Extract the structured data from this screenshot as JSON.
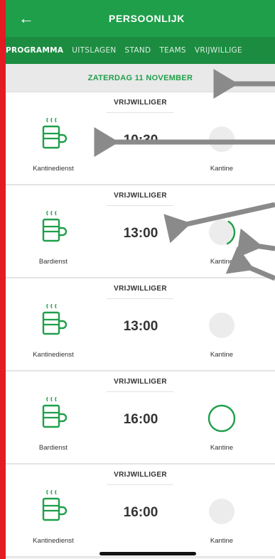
{
  "header": {
    "title": "PERSOONLIJK"
  },
  "tabs": [
    {
      "label": "PROGRAMMA",
      "active": true
    },
    {
      "label": "UITSLAGEN",
      "active": false
    },
    {
      "label": "STAND",
      "active": false
    },
    {
      "label": "TEAMS",
      "active": false
    },
    {
      "label": "VRIJWILLIGE",
      "active": false
    }
  ],
  "date": "ZATERDAG 11 NOVEMBER",
  "shifts": [
    {
      "role": "VRIJWILLIGER",
      "time": "10:30",
      "service": "Kantinedienst",
      "location": "Kantine",
      "ring_progress": 0
    },
    {
      "role": "VRIJWILLIGER",
      "time": "13:00",
      "service": "Bardienst",
      "location": "Kantine",
      "ring_progress": 0.35
    },
    {
      "role": "VRIJWILLIGER",
      "time": "13:00",
      "service": "Kantinedienst",
      "location": "Kantine",
      "ring_progress": 0
    },
    {
      "role": "VRIJWILLIGER",
      "time": "16:00",
      "service": "Bardienst",
      "location": "Kantine",
      "ring_progress": 1
    },
    {
      "role": "VRIJWILLIGER",
      "time": "16:00",
      "service": "Kantinedienst",
      "location": "Kantine",
      "ring_progress": 0
    }
  ],
  "colors": {
    "brand_green": "#1f9f4a",
    "tab_bar": "#1c8c41",
    "frame_red": "#e31b23",
    "annotation_arrow": "#8a8a8a"
  }
}
